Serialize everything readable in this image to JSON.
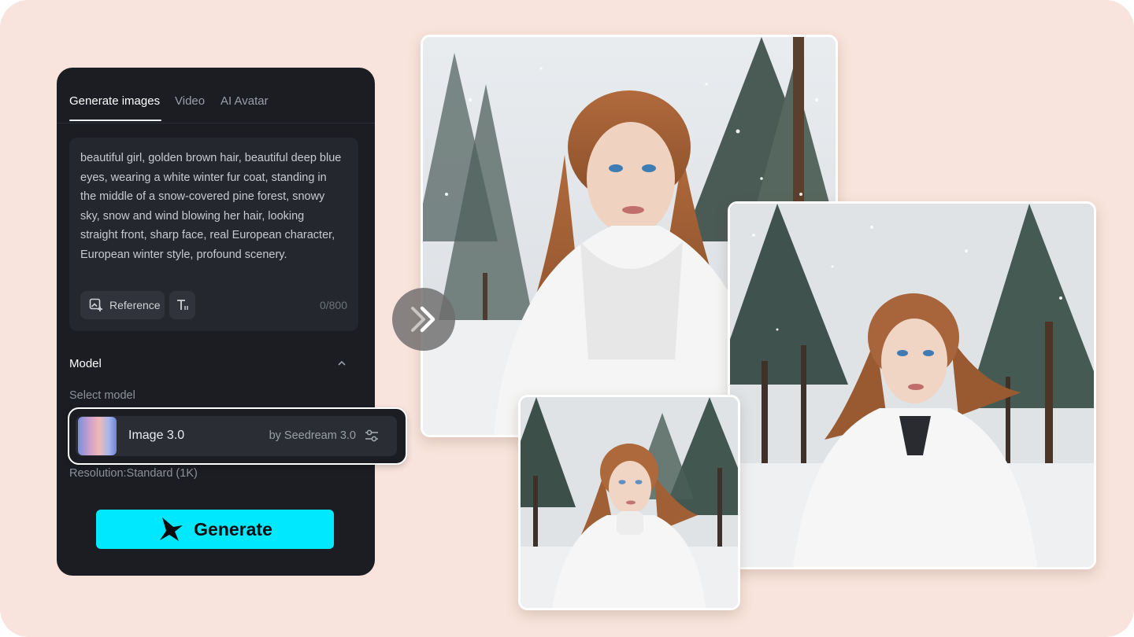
{
  "tabs": [
    {
      "label": "Generate images",
      "active": true
    },
    {
      "label": "Video",
      "active": false
    },
    {
      "label": "AI Avatar",
      "active": false
    }
  ],
  "prompt": {
    "text": "beautiful girl, golden brown hair, beautiful deep blue eyes, wearing a white winter fur coat, standing in the middle of a snow-covered pine forest, snowy sky, snow and wind blowing her hair, looking straight front, sharp face, real European character, European winter style, profound scenery.",
    "reference_label": "Reference",
    "counter": "0/800"
  },
  "model": {
    "section_label": "Model",
    "select_label": "Select model",
    "name": "Image 3.0",
    "provider": "by Seedream 3.0",
    "resolution": "Resolution:Standard (1K)"
  },
  "generate_label": "Generate",
  "colors": {
    "background": "#f8e4dc",
    "panel": "#1b1d23",
    "accent": "#00e8fd"
  },
  "icons": [
    "reference-image-icon",
    "text-style-icon",
    "chevron-up-icon",
    "settings-sliders-icon",
    "generate-logo-icon",
    "double-chevron-right-icon"
  ]
}
